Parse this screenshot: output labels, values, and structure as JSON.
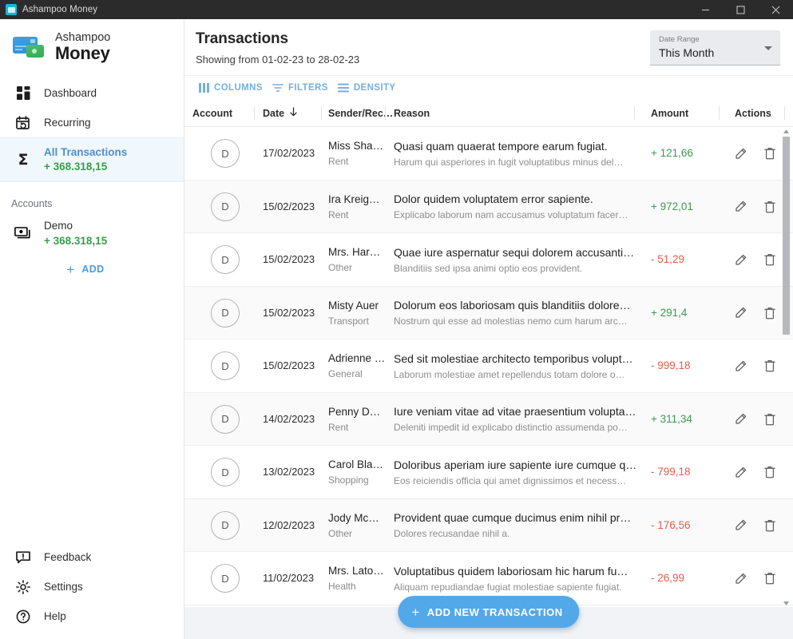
{
  "window": {
    "title": "Ashampoo Money",
    "app_icon": "money-app-icon",
    "minimize_label": "Minimize",
    "maximize_label": "Maximize",
    "close_label": "Close"
  },
  "sidebar": {
    "brand": {
      "top": "Ashampoo",
      "bottom": "Money",
      "logo_icon": "credit-cards-icon"
    },
    "nav": [
      {
        "label": "Dashboard",
        "icon": "dashboard-grid-icon",
        "active": false
      },
      {
        "label": "Recurring",
        "icon": "calendar-refresh-icon",
        "active": false
      },
      {
        "label": "All Transactions",
        "sub": "+ 368.318,15",
        "icon": "sigma-icon",
        "active": true
      }
    ],
    "accounts_label": "Accounts",
    "accounts": [
      {
        "name": "Demo",
        "balance": "+ 368.318,15",
        "icon": "banknotes-icon"
      }
    ],
    "add": {
      "label": "ADD",
      "icon": "plus-icon"
    },
    "bottom_nav": [
      {
        "label": "Feedback",
        "icon": "feedback-icon"
      },
      {
        "label": "Settings",
        "icon": "gear-icon"
      },
      {
        "label": "Help",
        "icon": "help-circle-icon"
      }
    ]
  },
  "header": {
    "title": "Transactions",
    "subtitle": "Showing from 01-02-23 to 28-02-23",
    "date_range": {
      "label": "Date Range",
      "value": "This Month",
      "caret_icon": "chevron-down-icon"
    }
  },
  "toolbar": {
    "columns": {
      "label": "COLUMNS",
      "icon": "columns-icon"
    },
    "filters": {
      "label": "FILTERS",
      "icon": "filter-icon"
    },
    "density": {
      "label": "DENSITY",
      "icon": "density-icon"
    }
  },
  "table": {
    "columns": [
      {
        "key": "account",
        "label": "Account"
      },
      {
        "key": "date",
        "label": "Date",
        "sort": "desc",
        "sort_icon": "arrow-down-icon"
      },
      {
        "key": "sender",
        "label": "Sender/Rec…"
      },
      {
        "key": "reason",
        "label": "Reason"
      },
      {
        "key": "amount",
        "label": "Amount"
      },
      {
        "key": "actions",
        "label": "Actions"
      }
    ],
    "rows": [
      {
        "avatar": "D",
        "date": "17/02/2023",
        "sender": "Miss Sha…",
        "category": "Rent",
        "reason": "Quasi quam quaerat tempore earum fugiat.",
        "note": "Harum qui asperiores in fugit voluptatibus minus del…",
        "amount": "+ 121,66",
        "sign": "positive"
      },
      {
        "avatar": "D",
        "date": "15/02/2023",
        "sender": "Ira Kreige…",
        "category": "Rent",
        "reason": "Dolor quidem voluptatem error sapiente.",
        "note": "Explicabo laborum nam accusamus voluptatum facer…",
        "amount": "+ 972,01",
        "sign": "positive"
      },
      {
        "avatar": "D",
        "date": "15/02/2023",
        "sender": "Mrs. Har…",
        "category": "Other",
        "reason": "Quae iure aspernatur sequi dolorem accusanti…",
        "note": "Blanditiis sed ipsa animi optio eos provident.",
        "amount": "- 51,29",
        "sign": "negative"
      },
      {
        "avatar": "D",
        "date": "15/02/2023",
        "sender": "Misty Auer",
        "category": "Transport",
        "reason": "Dolorum eos laboriosam quis blanditiis dolore…",
        "note": "Nostrum qui esse ad molestias nemo cum harum arc…",
        "amount": "+ 291,4",
        "sign": "positive"
      },
      {
        "avatar": "D",
        "date": "15/02/2023",
        "sender": "Adrienne …",
        "category": "General",
        "reason": "Sed sit molestiae architecto temporibus volupt…",
        "note": "Laborum molestiae amet repellendus totam dolore o…",
        "amount": "- 999,18",
        "sign": "negative"
      },
      {
        "avatar": "D",
        "date": "14/02/2023",
        "sender": "Penny Da…",
        "category": "Rent",
        "reason": "Iure veniam vitae ad vitae praesentium volupta…",
        "note": "Deleniti impedit id explicabo distinctio assumenda po…",
        "amount": "+ 311,34",
        "sign": "positive"
      },
      {
        "avatar": "D",
        "date": "13/02/2023",
        "sender": "Carol Bla…",
        "category": "Shopping",
        "reason": "Doloribus aperiam iure sapiente iure cumque q…",
        "note": "Eos reiciendis officia qui amet dignissimos et necess…",
        "amount": "- 799,18",
        "sign": "negative"
      },
      {
        "avatar": "D",
        "date": "12/02/2023",
        "sender": "Jody Mc…",
        "category": "Other",
        "reason": "Provident quae cumque ducimus enim nihil pr…",
        "note": "Dolores recusandae nihil a.",
        "amount": "- 176,56",
        "sign": "negative"
      },
      {
        "avatar": "D",
        "date": "11/02/2023",
        "sender": "Mrs. Lato…",
        "category": "Health",
        "reason": "Voluptatibus quidem laboriosam hic harum fu…",
        "note": "Aliquam repudiandae fugiat molestiae sapiente fugiat.",
        "amount": "- 26,99",
        "sign": "negative"
      }
    ],
    "row_actions": {
      "edit": {
        "icon": "pencil-icon",
        "label": "Edit"
      },
      "delete": {
        "icon": "trash-icon",
        "label": "Delete"
      }
    }
  },
  "fab": {
    "label": "ADD NEW TRANSACTION",
    "icon": "plus-icon"
  },
  "colors": {
    "accent": "#53a8ea",
    "link": "#4e9cdb",
    "positive": "#3c9a50",
    "negative": "#ea5c48",
    "titlebar": "#2b2b2b",
    "sidebar_active_bg": "#f0f7fd",
    "page_bg": "#f1f3f6"
  }
}
